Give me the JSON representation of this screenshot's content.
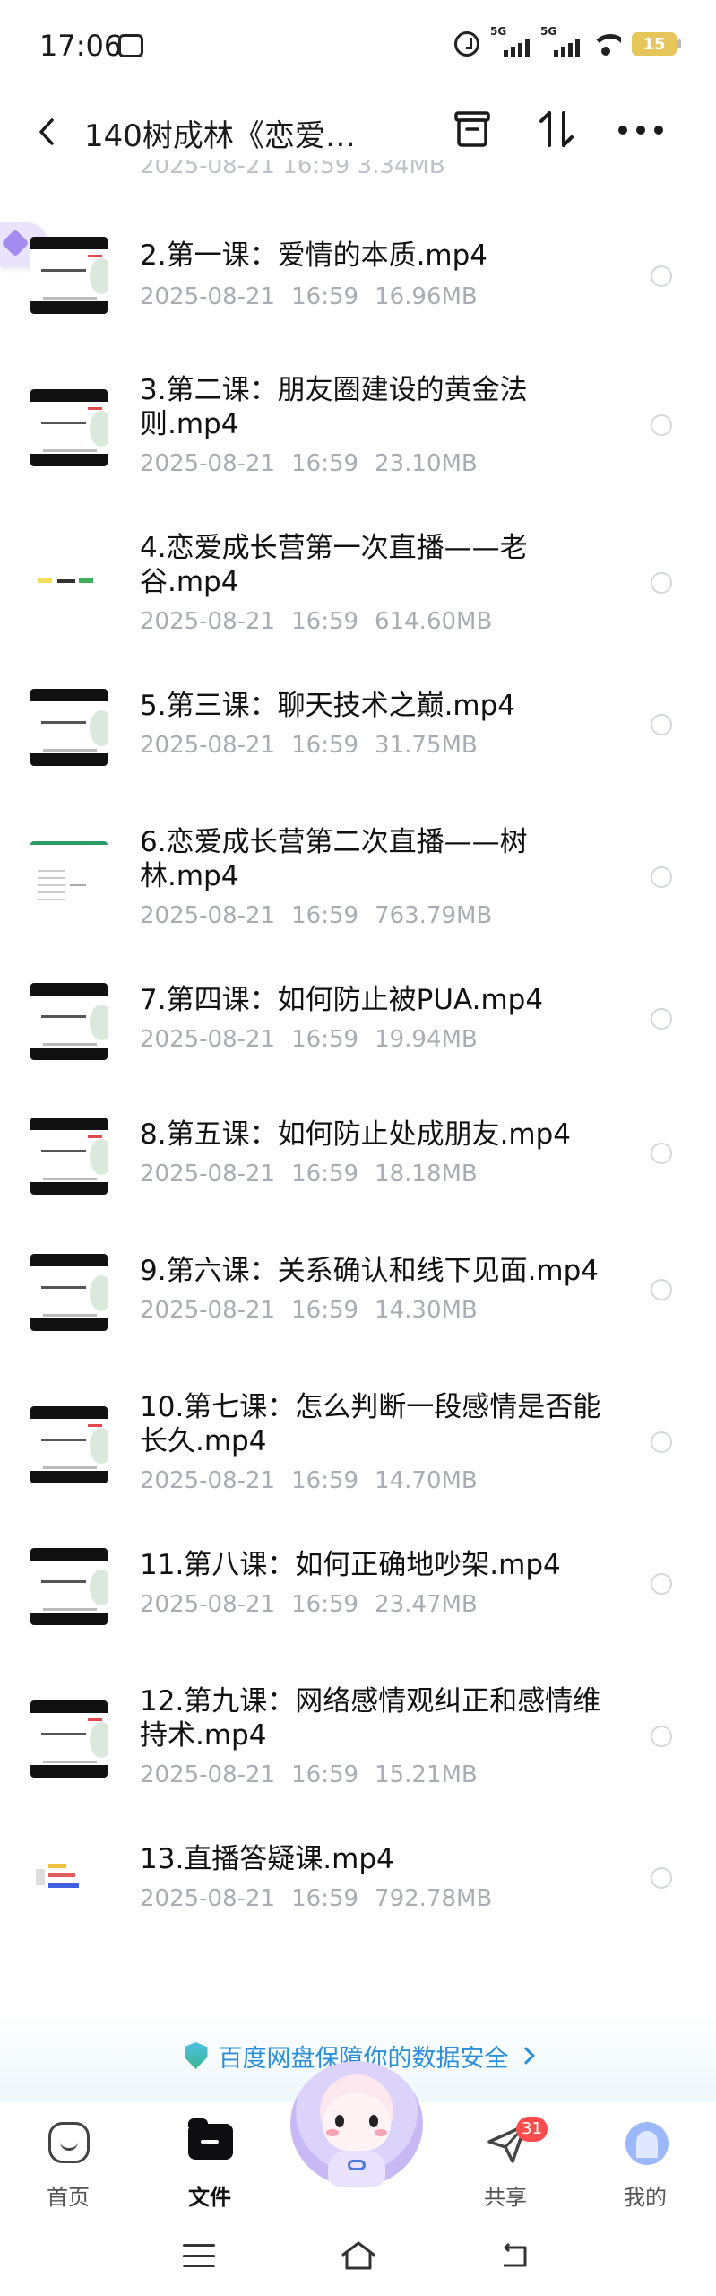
{
  "status_bar": {
    "time": "17:06",
    "network_1": "5G",
    "network_2": "5G",
    "battery": "15"
  },
  "header": {
    "title": "140树成林《恋爱…",
    "icons": [
      "back-icon",
      "box-icon",
      "sort-icon",
      "more-icon"
    ]
  },
  "partial_row": {
    "meta": "2025-08-21  16:59  3.34MB"
  },
  "files": [
    {
      "name": "2.第一课：爱情的本质.mp4",
      "date": "2025-08-21",
      "time": "16:59",
      "size": "16.96MB"
    },
    {
      "name": "3.第二课：朋友圈建设的黄金法则.mp4",
      "date": "2025-08-21",
      "time": "16:59",
      "size": "23.10MB"
    },
    {
      "name": "4.恋爱成长营第一次直播——老谷.mp4",
      "date": "2025-08-21",
      "time": "16:59",
      "size": "614.60MB"
    },
    {
      "name": "5.第三课：聊天技术之巅.mp4",
      "date": "2025-08-21",
      "time": "16:59",
      "size": "31.75MB"
    },
    {
      "name": "6.恋爱成长营第二次直播——树林.mp4",
      "date": "2025-08-21",
      "time": "16:59",
      "size": "763.79MB"
    },
    {
      "name": "7.第四课：如何防止被PUA.mp4",
      "date": "2025-08-21",
      "time": "16:59",
      "size": "19.94MB"
    },
    {
      "name": "8.第五课：如何防止处成朋友.mp4",
      "date": "2025-08-21",
      "time": "16:59",
      "size": "18.18MB"
    },
    {
      "name": "9.第六课：关系确认和线下见面.mp4",
      "date": "2025-08-21",
      "time": "16:59",
      "size": "14.30MB"
    },
    {
      "name": "10.第七课：怎么判断一段感情是否能长久.mp4",
      "date": "2025-08-21",
      "time": "16:59",
      "size": "14.70MB"
    },
    {
      "name": "11.第八课：如何正确地吵架.mp4",
      "date": "2025-08-21",
      "time": "16:59",
      "size": "23.47MB"
    },
    {
      "name": "12.第九课：网络感情观纠正和感情维持术.mp4",
      "date": "2025-08-21",
      "time": "16:59",
      "size": "15.21MB"
    },
    {
      "name": "13.直播答疑课.mp4",
      "date": "2025-08-21",
      "time": "16:59",
      "size": "792.78MB"
    }
  ],
  "security_banner": {
    "text": "百度网盘保障你的数据安全"
  },
  "tabbar": {
    "home": "首页",
    "files": "文件",
    "share": "共享",
    "share_badge": "31",
    "me": "我的"
  },
  "colors": {
    "accent": "#2a8fd8",
    "badge": "#ff4d4f",
    "meta_text": "#a9adb3"
  }
}
